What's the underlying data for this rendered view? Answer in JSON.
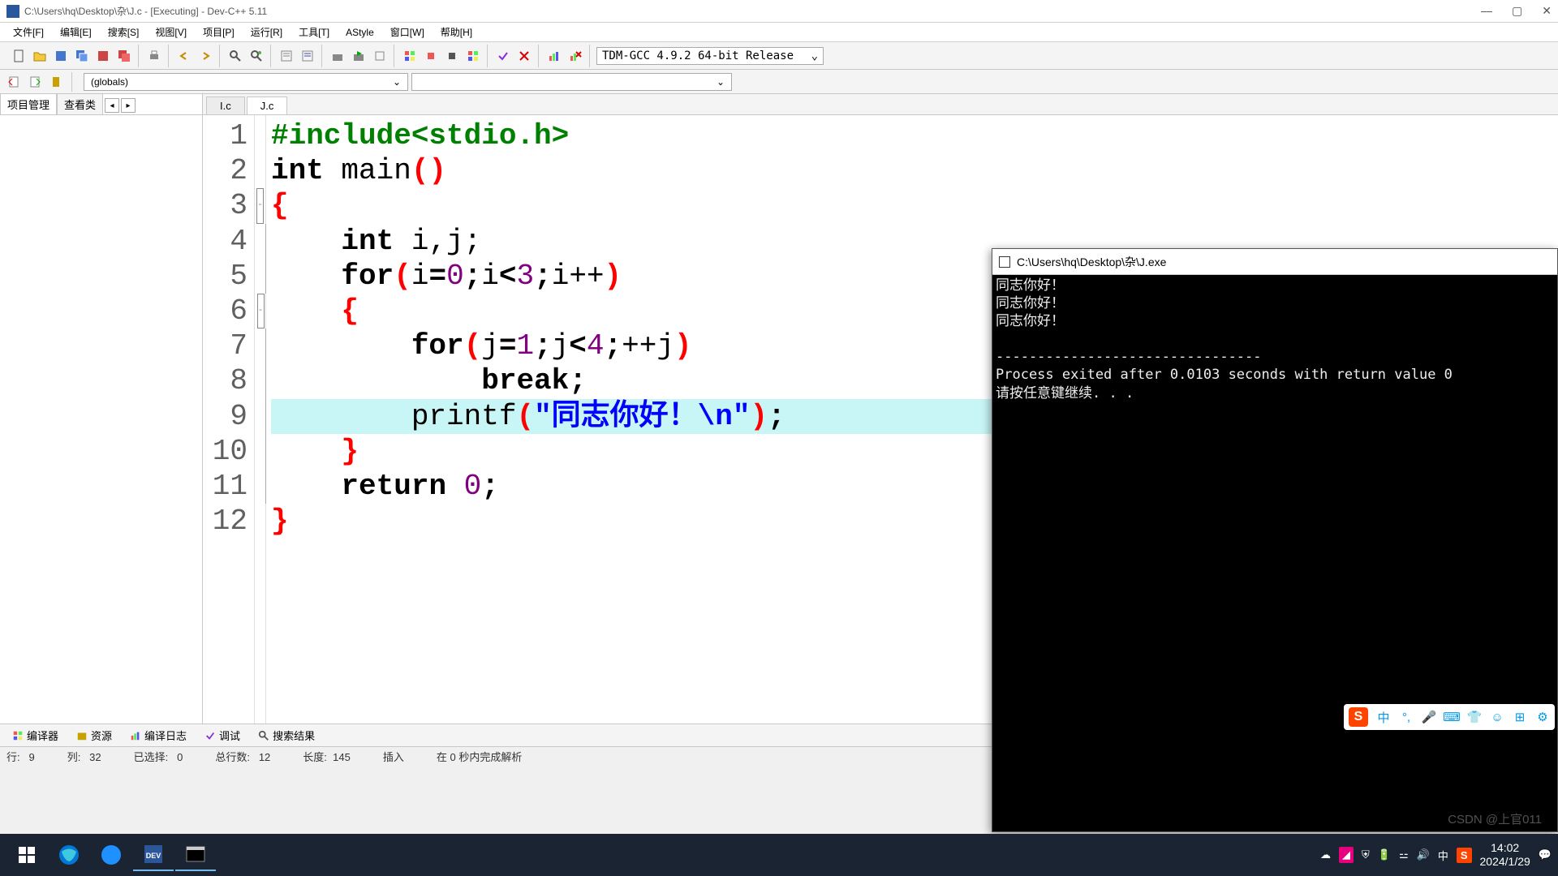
{
  "window": {
    "title": "C:\\Users\\hq\\Desktop\\杂\\J.c - [Executing] - Dev-C++ 5.11"
  },
  "menu": {
    "file": "文件[F]",
    "edit": "编辑[E]",
    "search": "搜索[S]",
    "view": "视图[V]",
    "project": "项目[P]",
    "run": "运行[R]",
    "tools": "工具[T]",
    "astyle": "AStyle",
    "window": "窗口[W]",
    "help": "帮助[H]"
  },
  "compiler": {
    "selected": "TDM-GCC 4.9.2 64-bit Release"
  },
  "scope": {
    "globals": "(globals)"
  },
  "left_tabs": {
    "proj": "项目管理",
    "classes": "查看类"
  },
  "file_tabs": {
    "t1": "I.c",
    "t2": "J.c"
  },
  "code": {
    "l1_pp": "#include<stdio.h>",
    "l2_kw1": "int",
    "l2_id": " main",
    "l2_p": "()",
    "l3": "{",
    "l4_kw": "int",
    "l4_rest": " i,j;",
    "l5_kw": "for",
    "l5_p1": "(",
    "l5_a": "i",
    "l5_eq": "=",
    "l5_n1": "0",
    "l5_s1": ";",
    "l5_b": "i",
    "l5_lt": "<",
    "l5_n2": "3",
    "l5_s2": ";",
    "l5_c": "i++",
    "l5_p2": ")",
    "l6": "{",
    "l7_kw": "for",
    "l7_p1": "(",
    "l7_a": "j",
    "l7_eq": "=",
    "l7_n1": "1",
    "l7_s1": ";",
    "l7_b": "j",
    "l7_lt": "<",
    "l7_n2": "4",
    "l7_s2": ";",
    "l7_c": "++j",
    "l7_p2": ")",
    "l8_kw": "break",
    "l8_s": ";",
    "l9_fn": "printf",
    "l9_p1": "(",
    "l9_str": "\"同志你好！\\n\"",
    "l9_p2": ")",
    "l9_s": ";",
    "l10": "}",
    "l11_kw": "return",
    "l11_sp": " ",
    "l11_n": "0",
    "l11_s": ";",
    "l12": "}"
  },
  "line_numbers": [
    "1",
    "2",
    "3",
    "4",
    "5",
    "6",
    "7",
    "8",
    "9",
    "10",
    "11",
    "12"
  ],
  "bottom": {
    "compiler": "编译器",
    "resources": "资源",
    "log": "编译日志",
    "debug": "调试",
    "results": "搜索结果"
  },
  "status": {
    "row_lbl": "行:",
    "row": "9",
    "col_lbl": "列:",
    "col": "32",
    "sel_lbl": "已选择:",
    "sel": "0",
    "total_lbl": "总行数:",
    "total": "12",
    "len_lbl": "长度:",
    "len": "145",
    "mode": "插入",
    "parse": "在 0 秒内完成解析"
  },
  "console": {
    "title": "C:\\Users\\hq\\Desktop\\杂\\J.exe",
    "out1": "同志你好！",
    "out2": "同志你好！",
    "out3": "同志你好！",
    "sep": "--------------------------------",
    "exit": "Process exited after 0.0103 seconds with return value 0",
    "prompt": "请按任意键继续. . ."
  },
  "ime": {
    "lang": "中"
  },
  "tray": {
    "time": "14:02",
    "date": "2024/1/29",
    "ime": "中"
  },
  "watermark": "CSDN @上官011"
}
